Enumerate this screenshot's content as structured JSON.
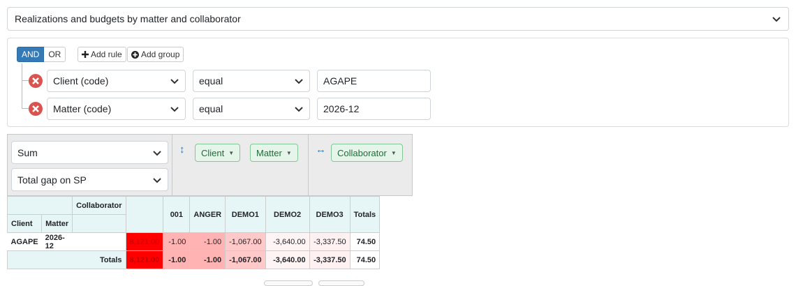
{
  "report": {
    "selected": "Realizations and budgets by matter and collaborator"
  },
  "query_builder": {
    "condition_and": "AND",
    "condition_or": "OR",
    "add_rule": "Add rule",
    "add_group": "Add group",
    "rules": [
      {
        "field": "Client (code)",
        "operator": "equal",
        "value": "AGAPE"
      },
      {
        "field": "Matter (code)",
        "operator": "equal",
        "value": "2026-12"
      }
    ]
  },
  "pivot": {
    "aggregator": "Sum",
    "attribute": "Total gap on SP",
    "row_fields": [
      "Client",
      "Matter"
    ],
    "col_fields": [
      "Collaborator"
    ],
    "col_header_label": "Collaborator",
    "row_header_labels": [
      "Client",
      "Matter"
    ],
    "columns": [
      "001",
      "ANGER",
      "DEMO1",
      "DEMO2",
      "DEMO3"
    ],
    "totals_label": "Totals",
    "rows": [
      {
        "client": "AGAPE",
        "matter": "2026-12",
        "first": "8,121.00",
        "values": [
          "-1.00",
          "-1.00",
          "-1,067.00",
          "-3,640.00",
          "-3,337.50"
        ],
        "total": "74.50"
      }
    ],
    "totals_row": {
      "first": "8,121.00",
      "values": [
        "-1.00",
        "-1.00",
        "-1,067.00",
        "-3,640.00",
        "-3,337.50"
      ],
      "total": "74.50"
    }
  },
  "colors": {
    "accent": "#337ab7",
    "heat_max": "#ff0000",
    "pill_bg": "#e6f5ea"
  }
}
